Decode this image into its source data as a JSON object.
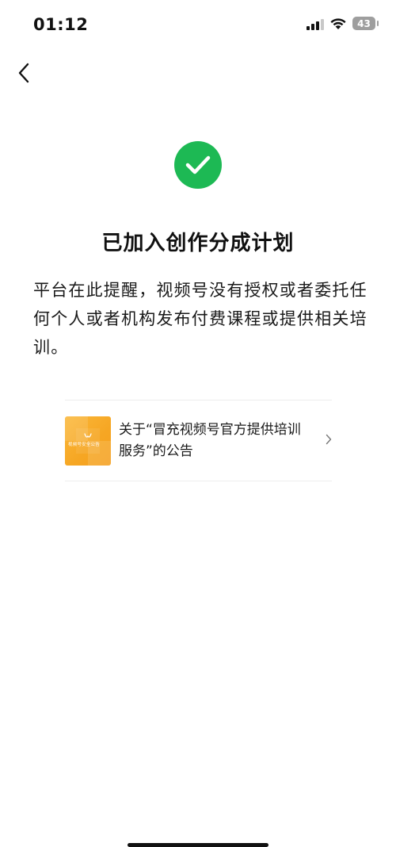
{
  "status_bar": {
    "time": "01:12",
    "battery": "43"
  },
  "nav": {
    "back_icon": "chevron-left-icon"
  },
  "result": {
    "icon": "check-circle-icon",
    "icon_color": "#1db954",
    "title": "已加入创作分成计划",
    "notice": "平台在此提醒，视频号没有授权或者委托任何个人或者机构发布付费课程或提供相关培训。"
  },
  "article": {
    "thumbnail_text": "视频号安全公告",
    "thumbnail_color": "#f6a623",
    "title": "关于“冒充视频号官方提供培训服务”的公告"
  }
}
